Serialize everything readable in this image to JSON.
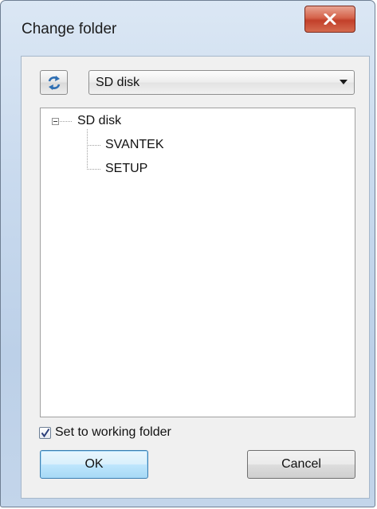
{
  "window": {
    "title": "Change folder",
    "close_icon": "close-x-icon"
  },
  "toolbar": {
    "refresh_icon": "refresh-arrows-icon",
    "drive_dropdown": {
      "selected": "SD disk"
    }
  },
  "tree": {
    "root": {
      "label": "SD disk",
      "expanded": true,
      "children": [
        {
          "label": "SVANTEK"
        },
        {
          "label": "SETUP"
        }
      ]
    }
  },
  "options": {
    "set_working_folder_label": "Set to working folder",
    "set_working_folder_checked": true
  },
  "buttons": {
    "ok_label": "OK",
    "cancel_label": "Cancel"
  },
  "colors": {
    "frame": "#c9daee",
    "close_button": "#c2402a",
    "default_button": "#a7d9f5"
  }
}
